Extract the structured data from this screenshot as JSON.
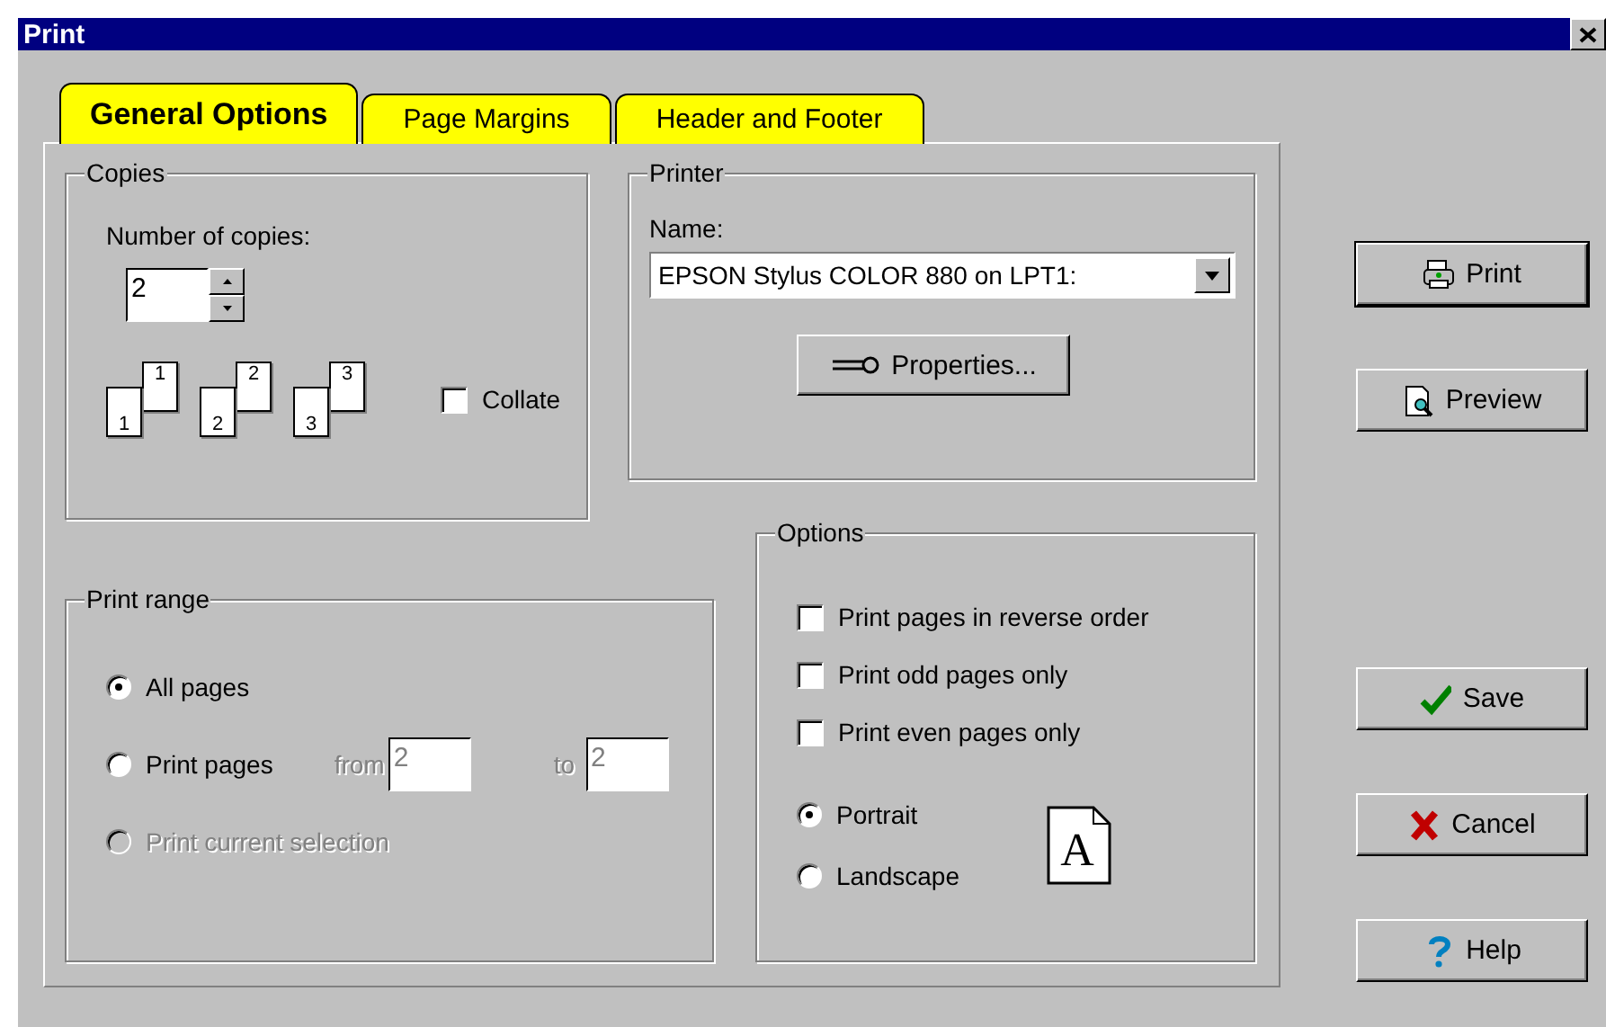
{
  "window": {
    "title": "Print"
  },
  "tabs": [
    {
      "label": "General Options",
      "selected": true
    },
    {
      "label": "Page Margins",
      "selected": false
    },
    {
      "label": "Header and Footer",
      "selected": false
    }
  ],
  "copies": {
    "title": "Copies",
    "label": "Number of copies:",
    "value": "2",
    "collate_pages": [
      {
        "back": "1",
        "front": "1"
      },
      {
        "back": "2",
        "front": "2"
      },
      {
        "back": "3",
        "front": "3"
      }
    ],
    "collate": {
      "label": "Collate",
      "checked": false
    }
  },
  "printer": {
    "title": "Printer",
    "name_label": "Name:",
    "name_value": "EPSON Stylus COLOR 880 on LPT1:",
    "properties_button": "Properties..."
  },
  "print_range": {
    "title": "Print range",
    "options": [
      {
        "kind": "plain",
        "label": "All pages",
        "selected": true,
        "disabled": false
      },
      {
        "kind": "pages",
        "label": "Print pages",
        "selected": false,
        "disabled": false,
        "from_label": "from",
        "from_value": "2",
        "to_label": "to",
        "to_value": "2",
        "fields_disabled": true
      },
      {
        "kind": "plain",
        "label": "Print current selection",
        "selected": false,
        "disabled": true
      }
    ]
  },
  "options": {
    "title": "Options",
    "checkboxes": [
      {
        "label": "Print pages in reverse order",
        "checked": false
      },
      {
        "label": "Print odd pages only",
        "checked": false
      },
      {
        "label": "Print even pages only",
        "checked": false
      }
    ],
    "orientation": [
      {
        "label": "Portrait",
        "selected": true
      },
      {
        "label": "Landscape",
        "selected": false
      }
    ],
    "orientation_icon_letter": "A"
  },
  "buttons": [
    {
      "kind": "print",
      "label": "Print",
      "default": true
    },
    {
      "kind": "preview",
      "label": "Preview",
      "default": false
    },
    {
      "kind": "save",
      "label": "Save",
      "default": false
    },
    {
      "kind": "cancel",
      "label": "Cancel",
      "default": false
    },
    {
      "kind": "help",
      "label": "Help",
      "default": false
    }
  ]
}
